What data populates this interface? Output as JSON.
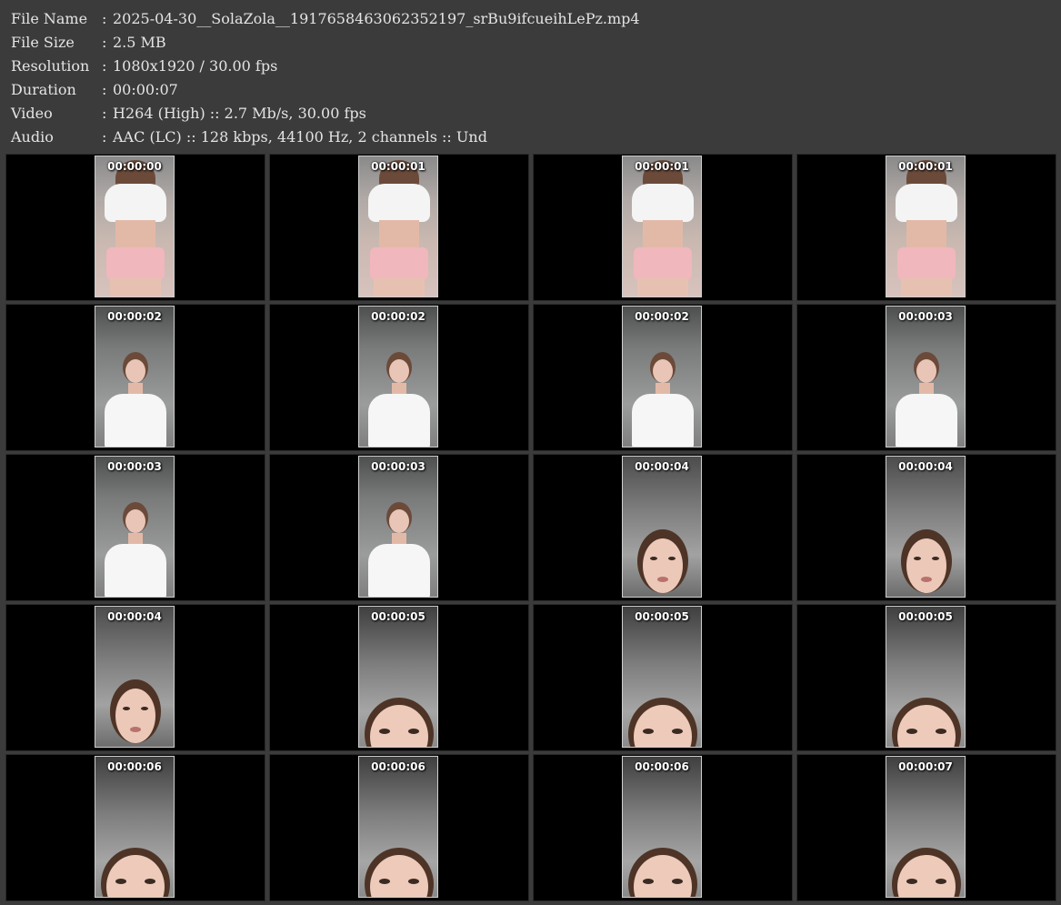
{
  "info": [
    {
      "label": "File Name",
      "value": "2025-04-30__SolaZola__1917658463062352197_srBu9ifcueihLePz.mp4"
    },
    {
      "label": "File Size",
      "value": "2.5 MB"
    },
    {
      "label": "Resolution",
      "value": "1080x1920 / 30.00 fps"
    },
    {
      "label": "Duration",
      "value": "00:00:07"
    },
    {
      "label": "Video",
      "value": "H264 (High) :: 2.7 Mb/s, 30.00 fps"
    },
    {
      "label": "Audio",
      "value": "AAC (LC) :: 128 kbps, 44100 Hz, 2 channels :: Und"
    }
  ],
  "separator": ":",
  "thumbnails": [
    {
      "time": "00:00:00",
      "scene": "torso-pink"
    },
    {
      "time": "00:00:01",
      "scene": "torso-pink"
    },
    {
      "time": "00:00:01",
      "scene": "torso-pink"
    },
    {
      "time": "00:00:01",
      "scene": "torso-pink"
    },
    {
      "time": "00:00:02",
      "scene": "upper-white"
    },
    {
      "time": "00:00:02",
      "scene": "upper-white"
    },
    {
      "time": "00:00:02",
      "scene": "upper-white"
    },
    {
      "time": "00:00:03",
      "scene": "upper-white"
    },
    {
      "time": "00:00:03",
      "scene": "upper-white"
    },
    {
      "time": "00:00:03",
      "scene": "upper-white"
    },
    {
      "time": "00:00:04",
      "scene": "face-mid"
    },
    {
      "time": "00:00:04",
      "scene": "face-mid"
    },
    {
      "time": "00:00:04",
      "scene": "face-mid"
    },
    {
      "time": "00:00:05",
      "scene": "face-low"
    },
    {
      "time": "00:00:05",
      "scene": "face-low"
    },
    {
      "time": "00:00:05",
      "scene": "face-low"
    },
    {
      "time": "00:00:06",
      "scene": "face-low"
    },
    {
      "time": "00:00:06",
      "scene": "face-low"
    },
    {
      "time": "00:00:06",
      "scene": "face-low"
    },
    {
      "time": "00:00:07",
      "scene": "face-low"
    }
  ]
}
